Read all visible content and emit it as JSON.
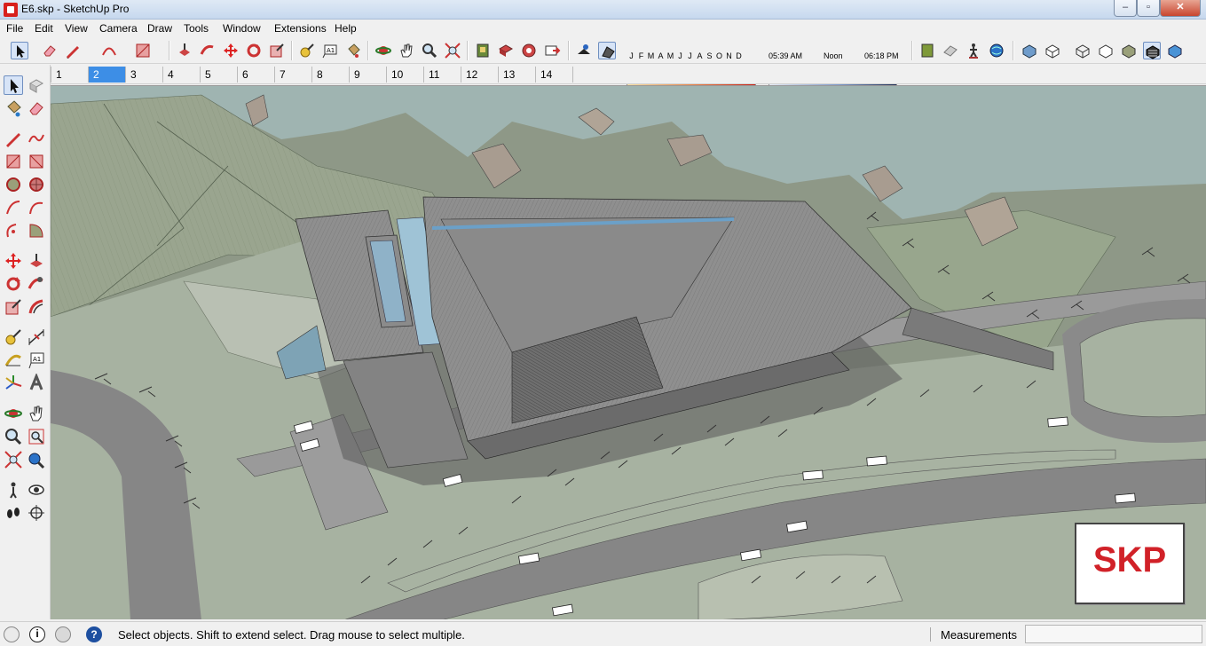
{
  "window": {
    "title": "E6.skp - SketchUp Pro",
    "controls": {
      "minimize": "–",
      "maximize": "▫",
      "close": "✕"
    }
  },
  "menu": {
    "items": [
      "File",
      "Edit",
      "View",
      "Camera",
      "Draw",
      "Tools",
      "Window",
      "Extensions",
      "Help"
    ]
  },
  "shadows": {
    "months": [
      "J",
      "F",
      "M",
      "A",
      "M",
      "J",
      "J",
      "A",
      "S",
      "O",
      "N",
      "D"
    ],
    "time_start": "05:39 AM",
    "time_mid": "Noon",
    "time_end": "06:18 PM"
  },
  "scenes": {
    "tabs": [
      "1",
      "2",
      "3",
      "4",
      "5",
      "6",
      "7",
      "8",
      "9",
      "10",
      "11",
      "12",
      "13",
      "14"
    ],
    "active_index": 1
  },
  "logo": {
    "text": "SKP",
    "color": "#d12128"
  },
  "status": {
    "message": "Select objects. Shift to extend select. Drag mouse to select multiple.",
    "measurements_label": "Measurements",
    "measurements_value": ""
  },
  "colors": {
    "accent": "#3d8ee6",
    "water": "#9fb4b1",
    "terrain": "#a7b2a1",
    "road": "#878787",
    "roof": "#8c8c8c"
  }
}
